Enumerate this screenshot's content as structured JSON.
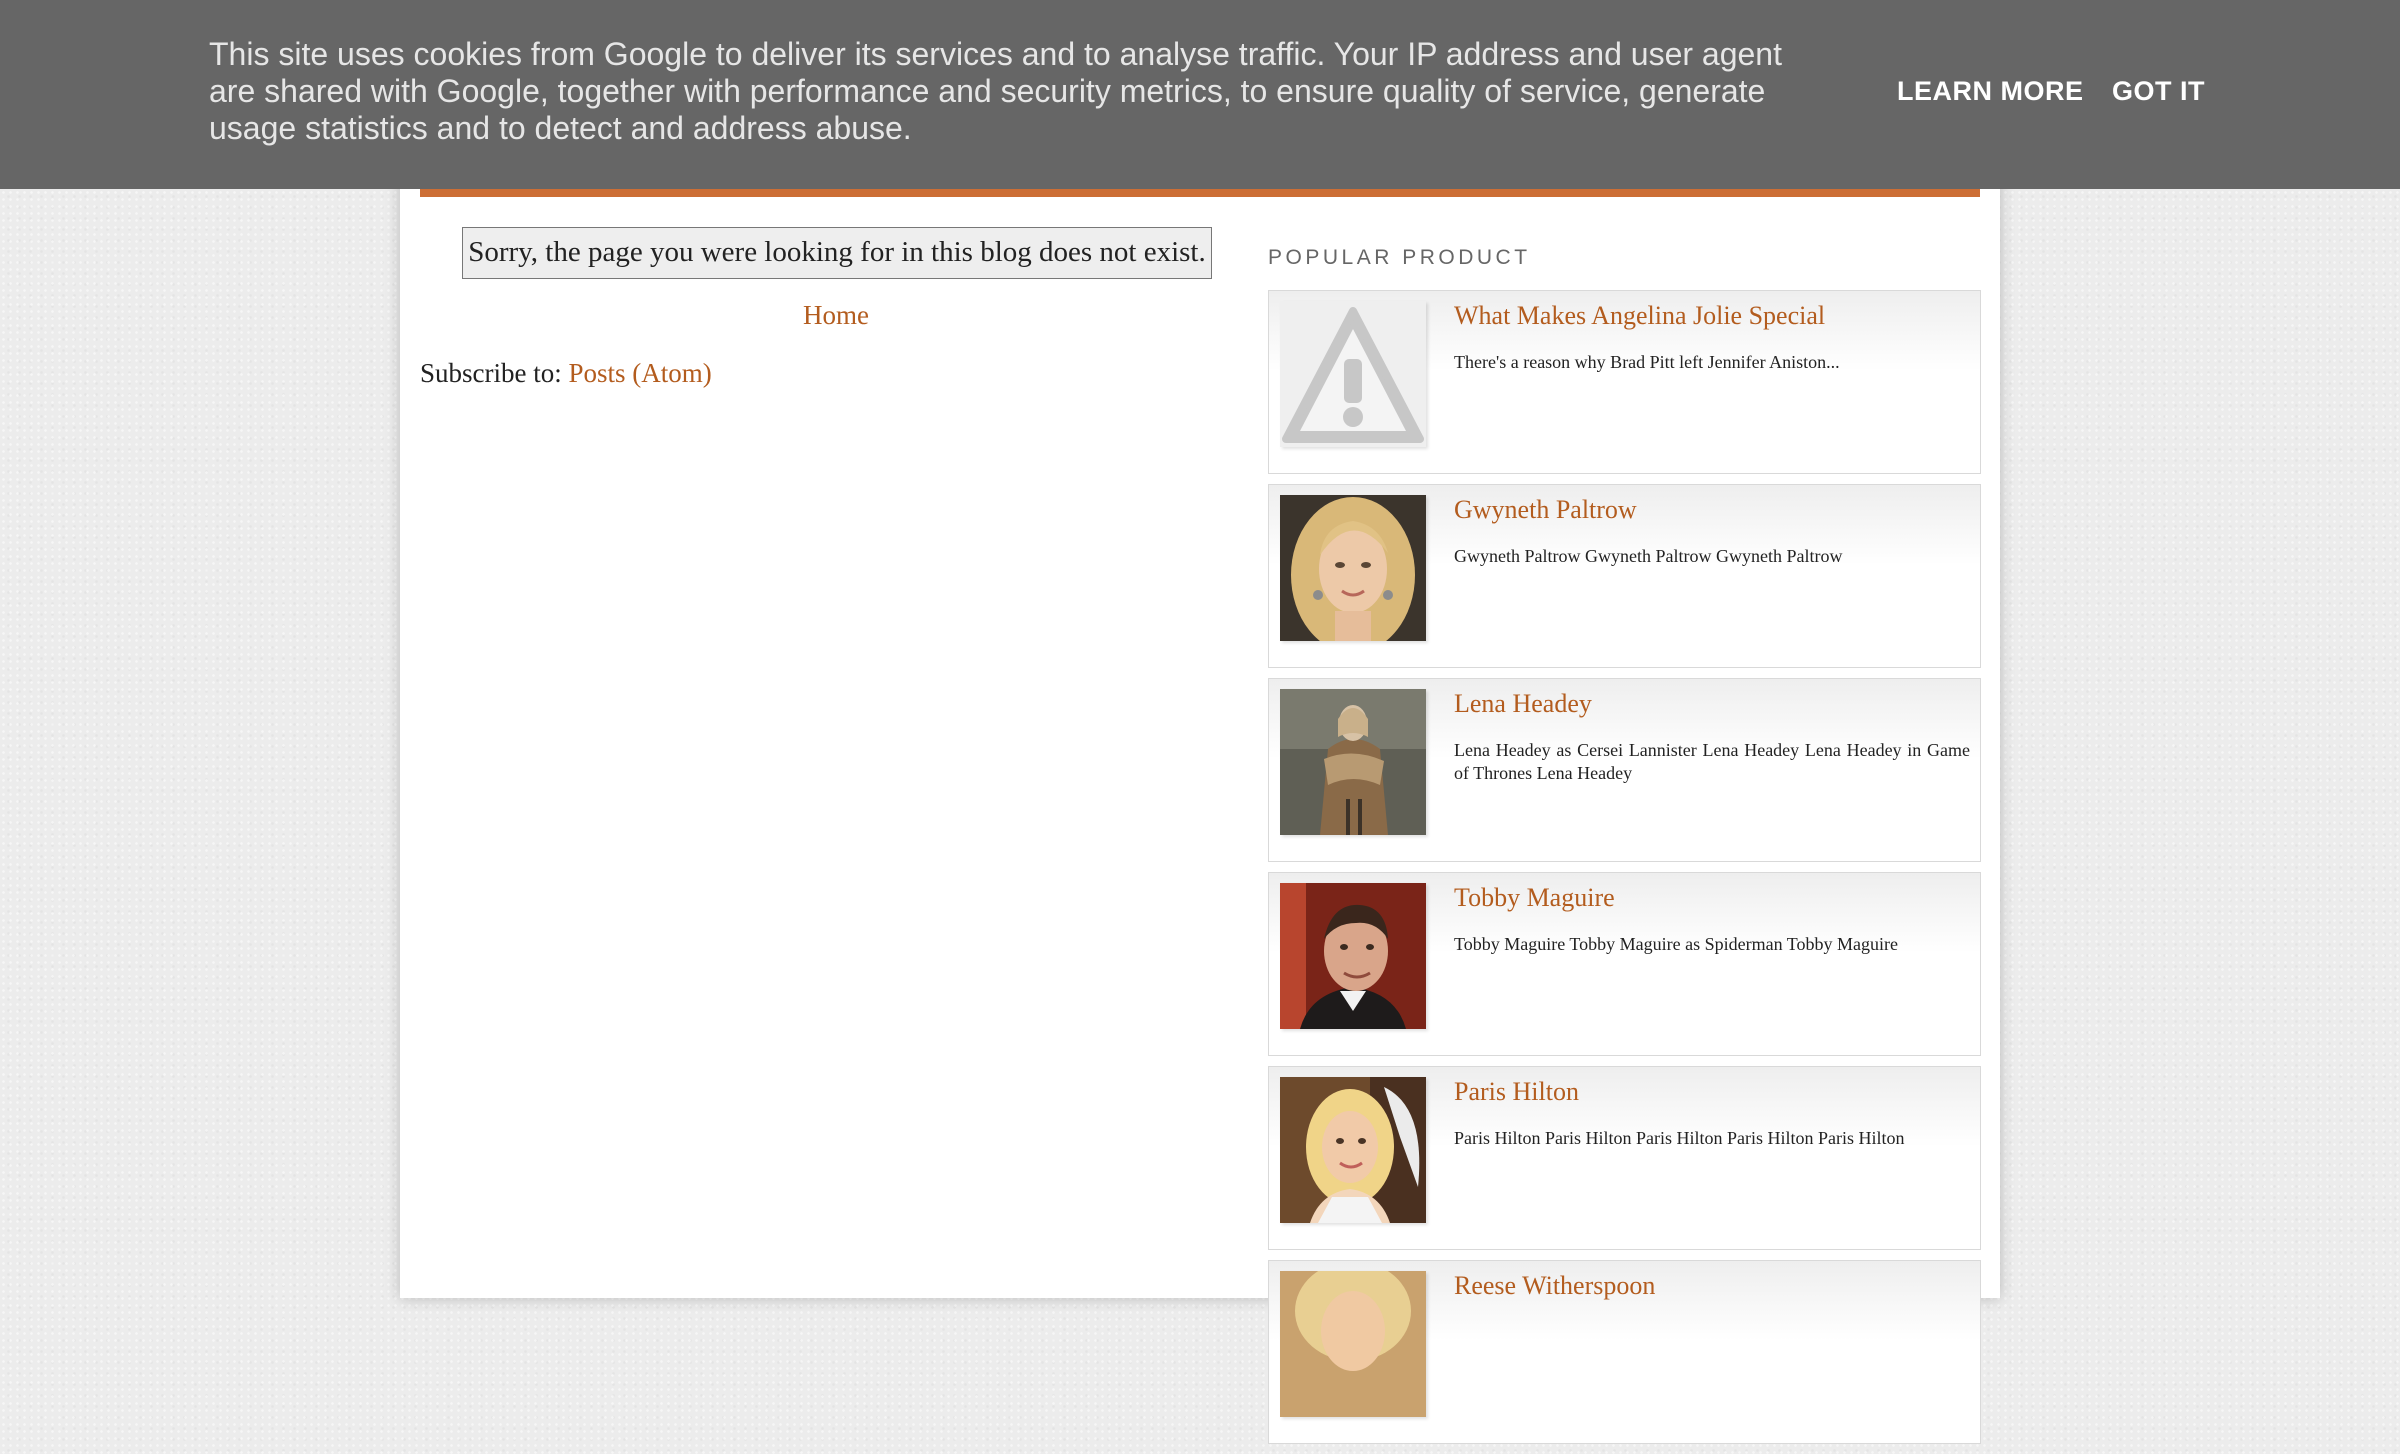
{
  "cookie_banner": {
    "text": "This site uses cookies from Google to deliver its services and to analyse traffic. Your IP address and user agent are shared with Google, together with performance and security metrics, to ensure quality of service, generate usage statistics and to detect and address abuse.",
    "learn_more_label": "LEARN MORE",
    "got_it_label": "GOT IT"
  },
  "main": {
    "error_message": "Sorry, the page you were looking for in this blog does not exist.",
    "home_link": "Home",
    "subscribe_prefix": "Subscribe to: ",
    "subscribe_link": "Posts (Atom)"
  },
  "sidebar": {
    "widget_title": "POPULAR PRODUCT",
    "posts": [
      {
        "title": "What Makes Angelina Jolie Special",
        "snippet": "There's a reason why Brad Pitt left Jennifer Aniston...",
        "thumb_icon": "broken-image-warning-icon"
      },
      {
        "title": "Gwyneth Paltrow",
        "snippet": " Gwyneth Paltrow  Gwyneth Paltrow Gwyneth Paltrow",
        "thumb_icon": "portrait-photo"
      },
      {
        "title": "Lena Headey",
        "snippet": " Lena Headey as Cersei Lannister  Lena Headey  Lena Headey in Game of Thrones Lena Headey",
        "thumb_icon": "portrait-photo"
      },
      {
        "title": "Tobby Maguire",
        "snippet": " Tobby Maguire  Tobby Maguire as Spiderman Tobby Maguire",
        "thumb_icon": "portrait-photo"
      },
      {
        "title": "Paris Hilton",
        "snippet": "  Paris Hilton   Paris Hilton Paris Hilton   Paris Hilton Paris Hilton",
        "thumb_icon": "portrait-photo"
      },
      {
        "title": "Reese Witherspoon",
        "snippet": "",
        "thumb_icon": "portrait-photo"
      }
    ]
  },
  "colors": {
    "accent_orange": "#cc6e35",
    "link": "#b35c1e",
    "banner_bg": "#666666"
  }
}
